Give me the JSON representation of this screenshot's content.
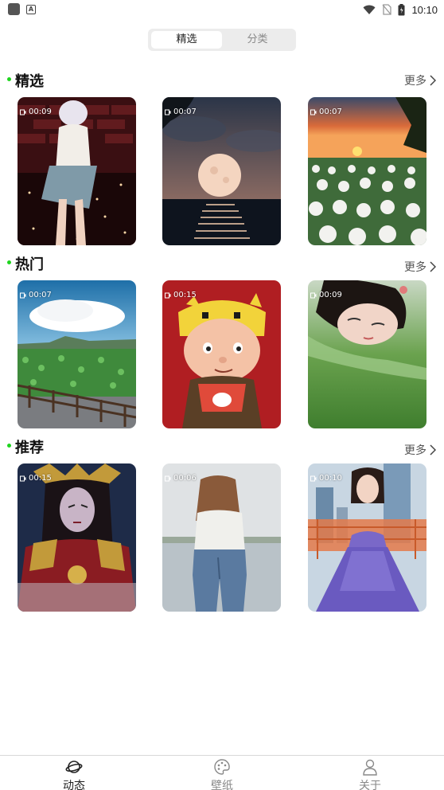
{
  "status_bar": {
    "time": "10:10"
  },
  "segment": {
    "tabs": [
      "精选",
      "分类"
    ],
    "active": 0
  },
  "sections": [
    {
      "title": "精选",
      "more": "更多",
      "items": [
        {
          "duration": "00:09",
          "subject": "dancer on dark stage"
        },
        {
          "duration": "00:07",
          "subject": "full moon over water"
        },
        {
          "duration": "00:07",
          "subject": "sunset over white tulips"
        }
      ]
    },
    {
      "title": "热门",
      "more": "更多",
      "items": [
        {
          "duration": "00:07",
          "subject": "cloud over lotus pond"
        },
        {
          "duration": "00:15",
          "subject": "cartoon boy with tiger hat"
        },
        {
          "duration": "00:09",
          "subject": "girl lying in grass"
        }
      ]
    },
    {
      "title": "推荐",
      "more": "更多",
      "items": [
        {
          "duration": "00:15",
          "subject": "armored fantasy character"
        },
        {
          "duration": "00:06",
          "subject": "woman in jeans by lake"
        },
        {
          "duration": "00:10",
          "subject": "woman in sequin gown"
        }
      ]
    }
  ],
  "bottom_nav": [
    {
      "label": "动态",
      "icon": "planet-icon",
      "active": true
    },
    {
      "label": "壁纸",
      "icon": "palette-icon",
      "active": false
    },
    {
      "label": "关于",
      "icon": "person-icon",
      "active": false
    }
  ],
  "colors": {
    "accent_dot": "#1fd51f",
    "segment_bg": "#ececec"
  }
}
